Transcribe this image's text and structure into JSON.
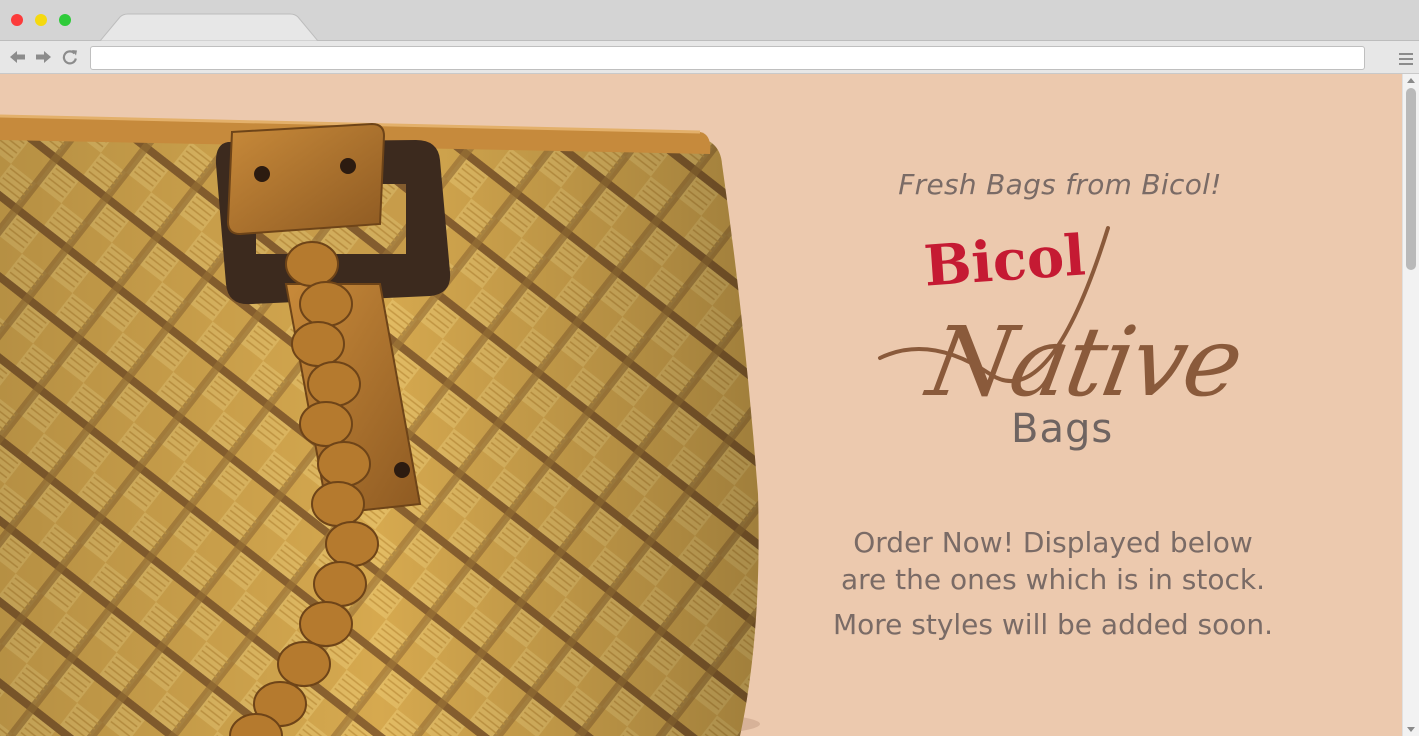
{
  "browser": {
    "url": "",
    "controls": {
      "close": "close",
      "minimize": "minimize",
      "maximize": "maximize"
    },
    "icons": {
      "back": "back-arrow-icon",
      "forward": "forward-arrow-icon",
      "reload": "reload-icon",
      "menu": "hamburger-menu-icon"
    }
  },
  "hero": {
    "image": "woven-native-bag",
    "tagline": "Fresh Bags from Bicol!",
    "logo": {
      "word1": "Bicol",
      "word2": "Native",
      "word3": "Bags"
    },
    "message": {
      "line1": "Order Now! Displayed below",
      "line2": "are the ones which is in stock.",
      "line3": "More styles will be added soon."
    }
  },
  "colors": {
    "background": "#ecc9ae",
    "logo_red": "#c51a33",
    "logo_brown": "#8a5a3b",
    "text_gray": "#7a6b66"
  }
}
